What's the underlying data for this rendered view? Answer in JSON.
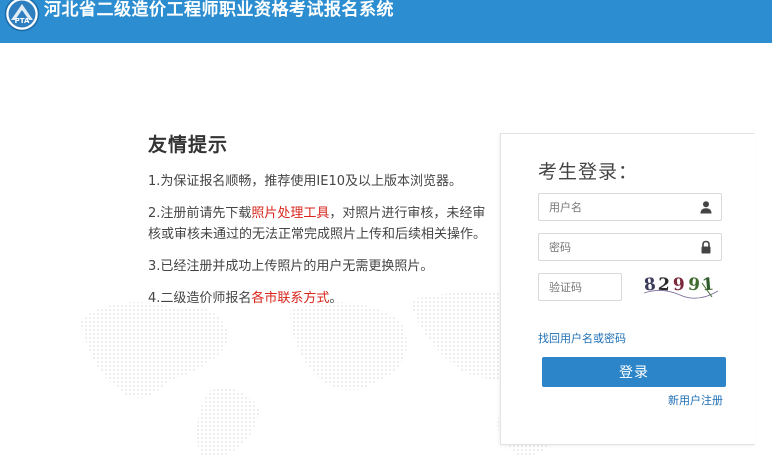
{
  "header": {
    "title": "河北省二级造价工程师职业资格考试报名系统",
    "logo_text": "PTA",
    "bg_color": "#2c8ed0"
  },
  "tips": {
    "title": "友情提示",
    "item1": "1.为保证报名顺畅，推荐使用IE10及以上版本浏览器。",
    "item2_prefix": "2.注册前请先下载",
    "item2_link": "照片处理工具",
    "item2_suffix": "，对照片进行审核，未经审核或审核未通过的无法正常完成照片上传和后续相关操作。",
    "item3": "3.已经注册并成功上传照片的用户无需更换照片。",
    "item4_prefix": "4.二级造价师报名",
    "item4_link": "各市联系方式",
    "item4_suffix": "。",
    "highlight_color": "#d9261c"
  },
  "login": {
    "title": "考生登录：",
    "username_placeholder": "用户名",
    "username_icon": "user-icon",
    "password_placeholder": "密码",
    "password_icon": "lock-icon",
    "captcha_placeholder": "验证码",
    "captcha_chars": [
      "8",
      "2",
      "9",
      "9",
      "1"
    ],
    "forgot_link": "找回用户名或密码",
    "login_button": "登录",
    "register_link": "新用户注册",
    "accent_color": "#2c85c8"
  }
}
